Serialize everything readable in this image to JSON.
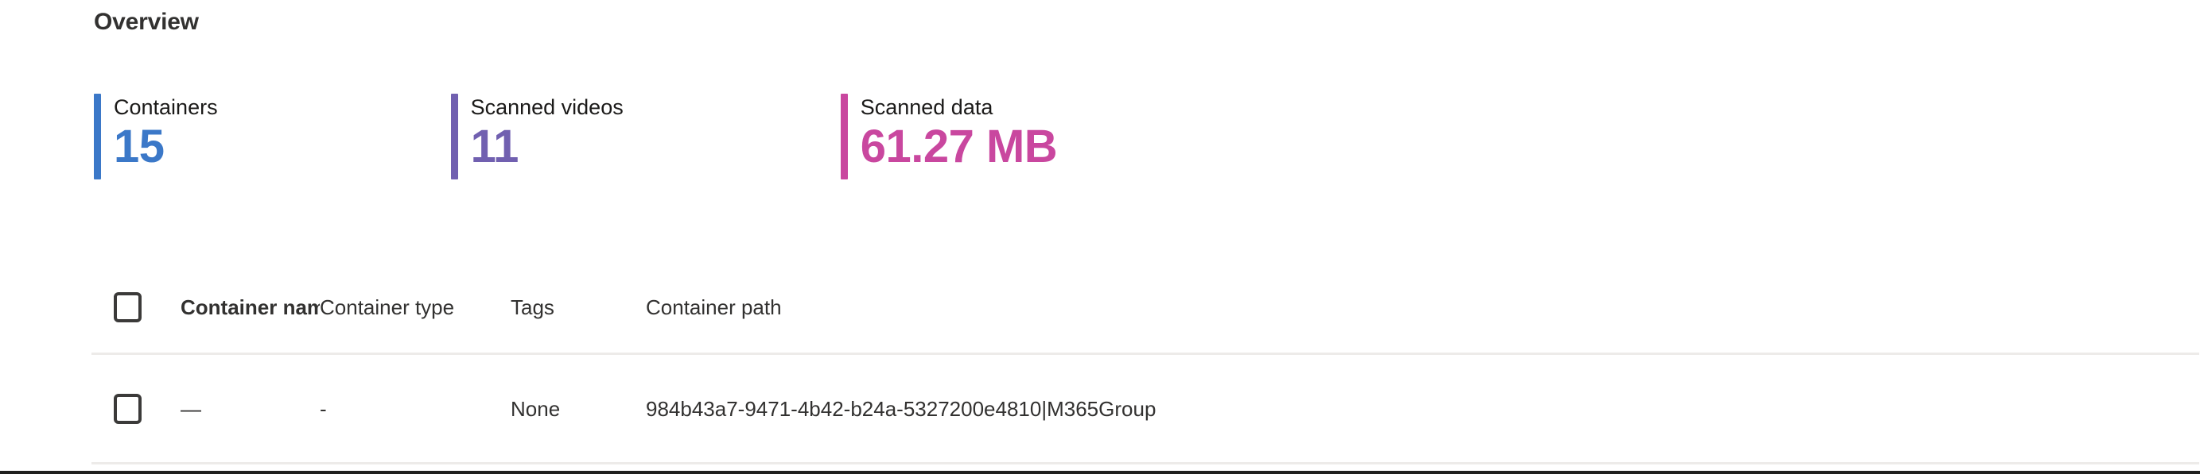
{
  "page": {
    "title": "Overview"
  },
  "metrics": [
    {
      "label": "Containers",
      "value": "15",
      "color": "#3b78c8",
      "name": "containers"
    },
    {
      "label": "Scanned videos",
      "value": "11",
      "color": "#7160b0",
      "name": "scanned-videos"
    },
    {
      "label": "Scanned data",
      "value": "61.27 MB",
      "color": "#c9479f",
      "name": "scanned-data"
    }
  ],
  "table": {
    "select_all_label": "",
    "columns": [
      {
        "key": "name",
        "label": "Container name",
        "sorted": true
      },
      {
        "key": "type",
        "label": "Container type",
        "sorted": false
      },
      {
        "key": "tags",
        "label": "Tags",
        "sorted": false
      },
      {
        "key": "path",
        "label": "Container path",
        "sorted": false
      }
    ],
    "rows": [
      {
        "name": "—",
        "type": "-",
        "tags": "None",
        "path": "984b43a7-9471-4b42-b24a-5327200e4810|M365Group"
      }
    ]
  }
}
